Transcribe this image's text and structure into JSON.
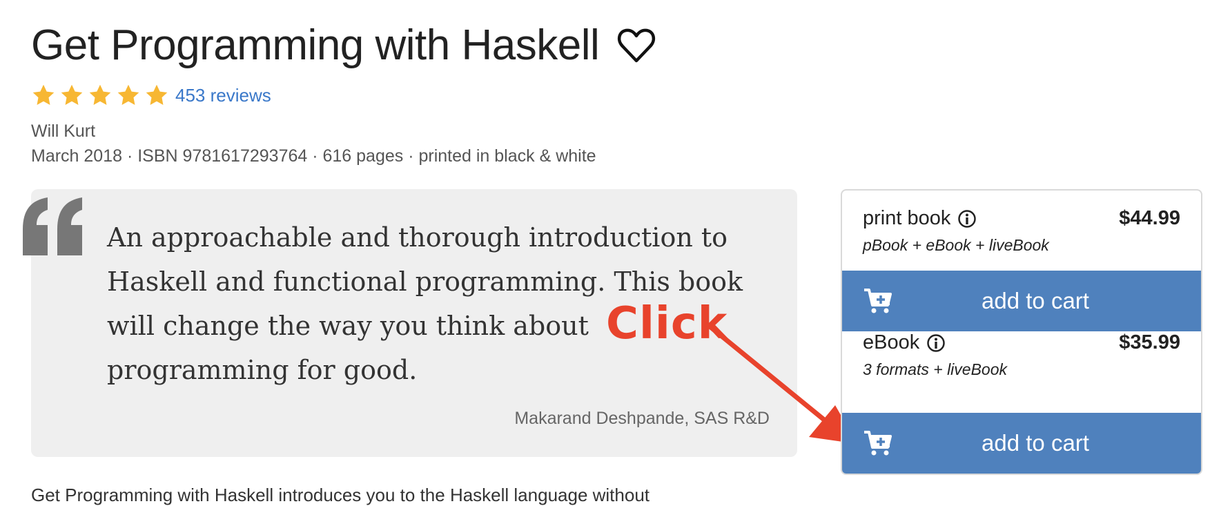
{
  "product": {
    "title": "Get Programming with Haskell",
    "favorite_icon": "heart-icon",
    "rating": {
      "stars": 5,
      "max": 5,
      "reviews": "453 reviews",
      "star_color": "#f7b733"
    },
    "author": "Will Kurt",
    "meta": "March 2018 · ISBN 9781617293764 · 616 pages · printed in black & white"
  },
  "quote": {
    "text": "An approachable and thorough introduction to Haskell and functional programming. This book will change the way you think about programming for good.",
    "attribution": "Makarand Deshpande, SAS R&D"
  },
  "annotation": {
    "label": "Click",
    "color": "#e8432c"
  },
  "purchase": {
    "options": [
      {
        "name": "print book",
        "price": "$44.99",
        "includes": "pBook + eBook + liveBook",
        "button": "add to cart"
      },
      {
        "name": "eBook",
        "price": "$35.99",
        "includes": "3 formats + liveBook",
        "button": "add to cart"
      }
    ],
    "button_color": "#4f81bd"
  },
  "description_partial": "Get Programming with Haskell introduces you to the Haskell language without"
}
